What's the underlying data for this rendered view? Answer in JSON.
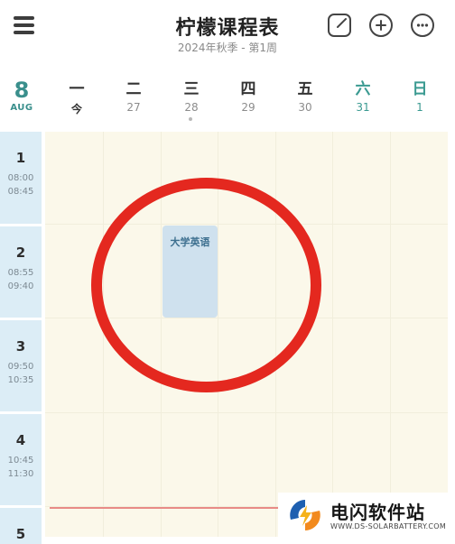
{
  "header": {
    "title": "柠檬课程表",
    "subtitle": "2024年秋季 - 第1周",
    "icons": [
      "menu-icon",
      "edit-icon",
      "add-icon",
      "more-icon"
    ]
  },
  "week": {
    "month_number": "8",
    "month_abbr": "AUG",
    "days": [
      {
        "name": "一",
        "date": "今"
      },
      {
        "name": "二",
        "date": "27"
      },
      {
        "name": "三",
        "date": "28"
      },
      {
        "name": "四",
        "date": "29"
      },
      {
        "name": "五",
        "date": "30"
      },
      {
        "name": "六",
        "date": "31"
      },
      {
        "name": "日",
        "date": "1"
      }
    ]
  },
  "periods": [
    {
      "number": "1",
      "start": "08:00",
      "end": "08:45"
    },
    {
      "number": "2",
      "start": "08:55",
      "end": "09:40"
    },
    {
      "number": "3",
      "start": "09:50",
      "end": "10:35"
    },
    {
      "number": "4",
      "start": "10:45",
      "end": "11:30"
    },
    {
      "number": "5",
      "start": "",
      "end": ""
    }
  ],
  "courses": [
    {
      "name": "大学英语"
    }
  ],
  "watermark": {
    "name": "电闪软件站",
    "url": "WWW.DS-SOLARBATTERY.COM"
  },
  "colors": {
    "accent": "#3a8f8c",
    "weekend": "#3a9a91",
    "grid_background": "#fbf8ea",
    "period_column": "#dcedf6",
    "course_block": "#cfe1ee",
    "annotation_circle": "#e4281f"
  }
}
